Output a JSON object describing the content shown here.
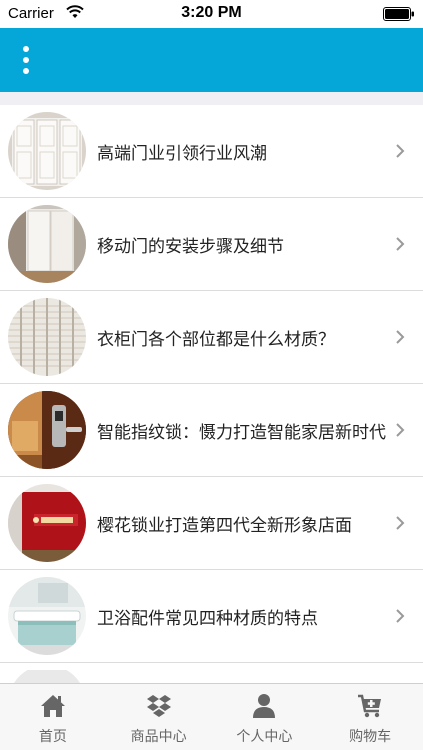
{
  "status_bar": {
    "carrier": "Carrier",
    "time": "3:20 PM"
  },
  "header": {
    "menu_icon": "vertical-dots-icon",
    "background_color": "#05a7d9"
  },
  "articles": [
    {
      "title": "高端门业引领行业风潮",
      "thumbnail": "white-wardrobe-doors"
    },
    {
      "title": "移动门的安装步骤及细节",
      "thumbnail": "sliding-door-room"
    },
    {
      "title": "衣柜门各个部位都是什么材质？",
      "thumbnail": "louvered-closet-doors"
    },
    {
      "title": "智能指纹锁：慑力打造智能家居新时代",
      "thumbnail": "fingerprint-lock-door"
    },
    {
      "title": "樱花锁业打造第四代全新形象店面",
      "thumbnail": "red-showroom-wall"
    },
    {
      "title": "卫浴配件常见四种材质的特点",
      "thumbnail": "bathroom-vanity"
    }
  ],
  "tabs": [
    {
      "label": "首页",
      "icon": "home-icon"
    },
    {
      "label": "商品中心",
      "icon": "dropbox-icon"
    },
    {
      "label": "个人中心",
      "icon": "person-icon"
    },
    {
      "label": "购物车",
      "icon": "cart-icon"
    }
  ]
}
